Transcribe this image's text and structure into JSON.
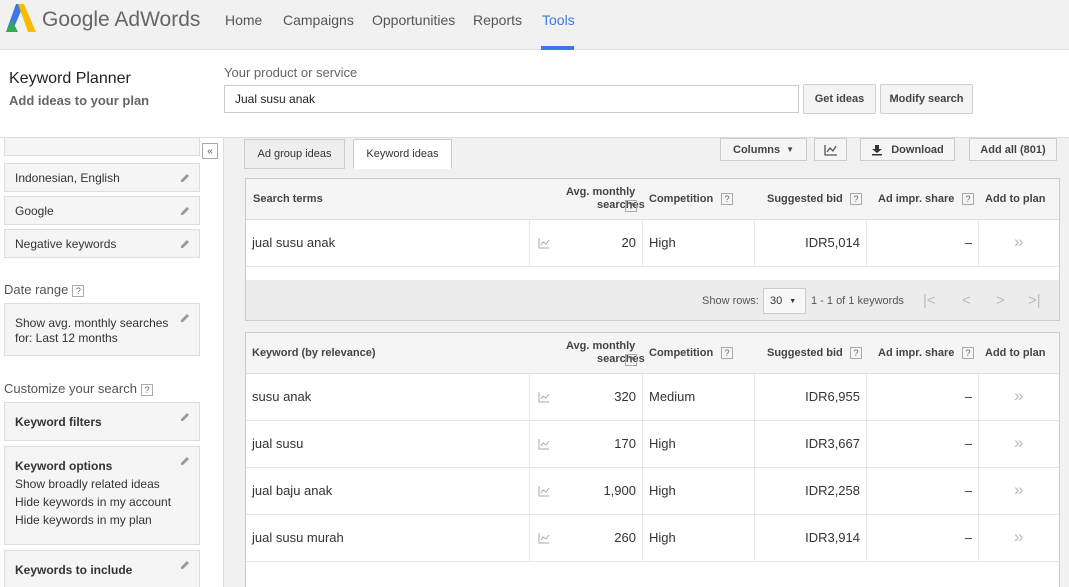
{
  "app": {
    "brand": "Google AdWords"
  },
  "nav": [
    {
      "label": "Home"
    },
    {
      "label": "Campaigns"
    },
    {
      "label": "Opportunities"
    },
    {
      "label": "Reports"
    },
    {
      "label": "Tools"
    }
  ],
  "header": {
    "title": "Keyword Planner",
    "subtitle": "Add ideas to your plan",
    "product_label": "Your product or service",
    "product_value": "Jual susu anak",
    "get_ideas": "Get ideas",
    "modify_search": "Modify search"
  },
  "sidebar": {
    "collapse_icon": "«",
    "targeting": [
      {
        "label": "Indonesian, English"
      },
      {
        "label": "Google"
      },
      {
        "label": "Negative keywords"
      }
    ],
    "date_range_label": "Date range",
    "date_range_value_1": "Show avg. monthly searches",
    "date_range_value_2": "for: Last 12 months",
    "customize_label": "Customize your search",
    "keyword_filters": "Keyword filters",
    "keyword_options": "Keyword options",
    "options": [
      "Show broadly related ideas",
      "Hide keywords in my account",
      "Hide keywords in my plan"
    ],
    "keywords_to_include": "Keywords to include",
    "help": "?"
  },
  "tabs": [
    {
      "label": "Ad group ideas"
    },
    {
      "label": "Keyword ideas"
    }
  ],
  "toolbar": {
    "columns": "Columns",
    "download": "Download",
    "add_all": "Add all (801)"
  },
  "search_table": {
    "headers": {
      "term": "Search terms",
      "avg1": "Avg. monthly",
      "avg2": "searches",
      "competition": "Competition",
      "bid": "Suggested bid",
      "impr": "Ad impr. share",
      "add": "Add to plan"
    },
    "rows": [
      {
        "keyword": "jual susu anak",
        "searches": "20",
        "competition": "High",
        "bid": "IDR5,014",
        "impr": "–"
      }
    ]
  },
  "pager": {
    "show_rows": "Show rows:",
    "rows_value": "30",
    "range": "1 - 1 of 1 keywords"
  },
  "ideas_table": {
    "headers": {
      "term": "Keyword (by relevance)",
      "avg1": "Avg. monthly",
      "avg2": "searches",
      "competition": "Competition",
      "bid": "Suggested bid",
      "impr": "Ad impr. share",
      "add": "Add to plan"
    },
    "rows": [
      {
        "keyword": "susu anak",
        "searches": "320",
        "competition": "Medium",
        "bid": "IDR6,955",
        "impr": "–"
      },
      {
        "keyword": "jual susu",
        "searches": "170",
        "competition": "High",
        "bid": "IDR3,667",
        "impr": "–"
      },
      {
        "keyword": "jual baju anak",
        "searches": "1,900",
        "competition": "High",
        "bid": "IDR2,258",
        "impr": "–"
      },
      {
        "keyword": "jual susu murah",
        "searches": "260",
        "competition": "High",
        "bid": "IDR3,914",
        "impr": "–"
      }
    ]
  },
  "colors": {
    "accent": "#3b78e7"
  }
}
